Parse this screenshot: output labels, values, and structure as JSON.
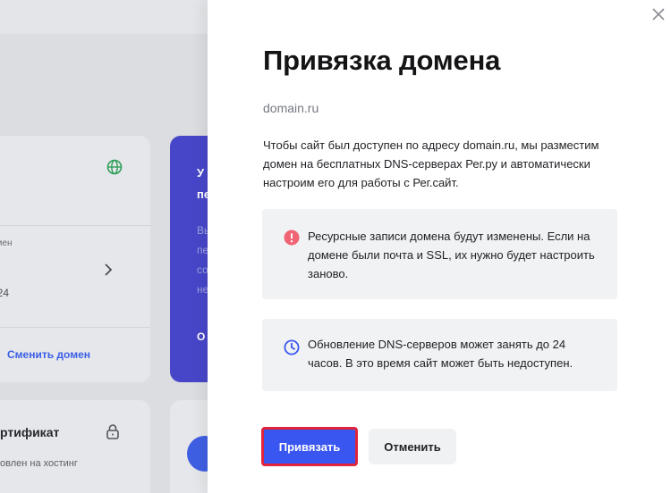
{
  "background": {
    "domain_card": {
      "small_label": "омен",
      "year": "024",
      "change_domain_link": "Сменить домен"
    },
    "blue_card": {
      "line1": "У",
      "line2": "пе",
      "faint_lines": [
        "Вы",
        "пе",
        "со",
        "не"
      ],
      "line3": "О"
    },
    "ssl_card": {
      "title": "ртификат",
      "subtitle": "овлен на хостинг"
    }
  },
  "modal": {
    "title": "Привязка домена",
    "domain": "domain.ru",
    "description": "Чтобы сайт был доступен по адресу domain.ru, мы разместим домен на бесплатных DNS-серверах Рег.ру и автоматически настроим его для работы с Рег.сайт.",
    "warning_alert": {
      "icon": "exclamation-icon",
      "text": "Ресурсные записи домена будут изменены. Если на домене были почта и SSL, их нужно будет настроить заново."
    },
    "info_alert": {
      "icon": "clock-icon",
      "text": "Обновление DNS-серверов может занять до 24 часов. В это время сайт может быть недоступен."
    },
    "buttons": {
      "primary": "Привязать",
      "secondary": "Отменить"
    }
  },
  "colors": {
    "accent": "#3a56f0",
    "focus_outline": "#e0243a",
    "warning": "#f06473",
    "info": "#3a56f0",
    "link": "#3a5ee8"
  }
}
